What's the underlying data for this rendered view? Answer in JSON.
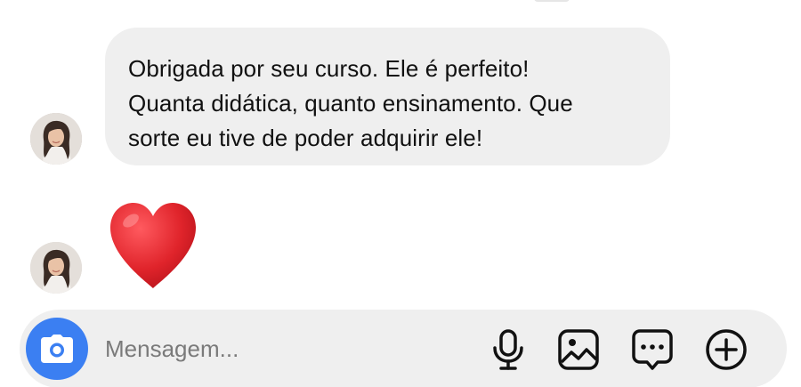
{
  "conversation": {
    "messages": [
      {
        "type": "text",
        "lines": [
          "Obrigada por seu curso. Ele é perfeito!",
          "Quanta didática, quanto ensinamento. Que",
          "sorte eu tive de poder adquirir ele!"
        ]
      },
      {
        "type": "emoji",
        "emoji": "❤️",
        "icon": "red-heart-icon"
      }
    ]
  },
  "composer": {
    "placeholder": "Mensagem...",
    "value": "",
    "icons": {
      "camera": "camera-icon",
      "mic": "microphone-icon",
      "gallery": "image-icon",
      "sticker": "sticker-icon",
      "plus": "plus-circle-icon"
    }
  },
  "colors": {
    "bubble": "#efefef",
    "accent": "#3b7ff2",
    "heart": "#e0242b",
    "text": "#111111",
    "placeholder": "#7a7a7a"
  }
}
